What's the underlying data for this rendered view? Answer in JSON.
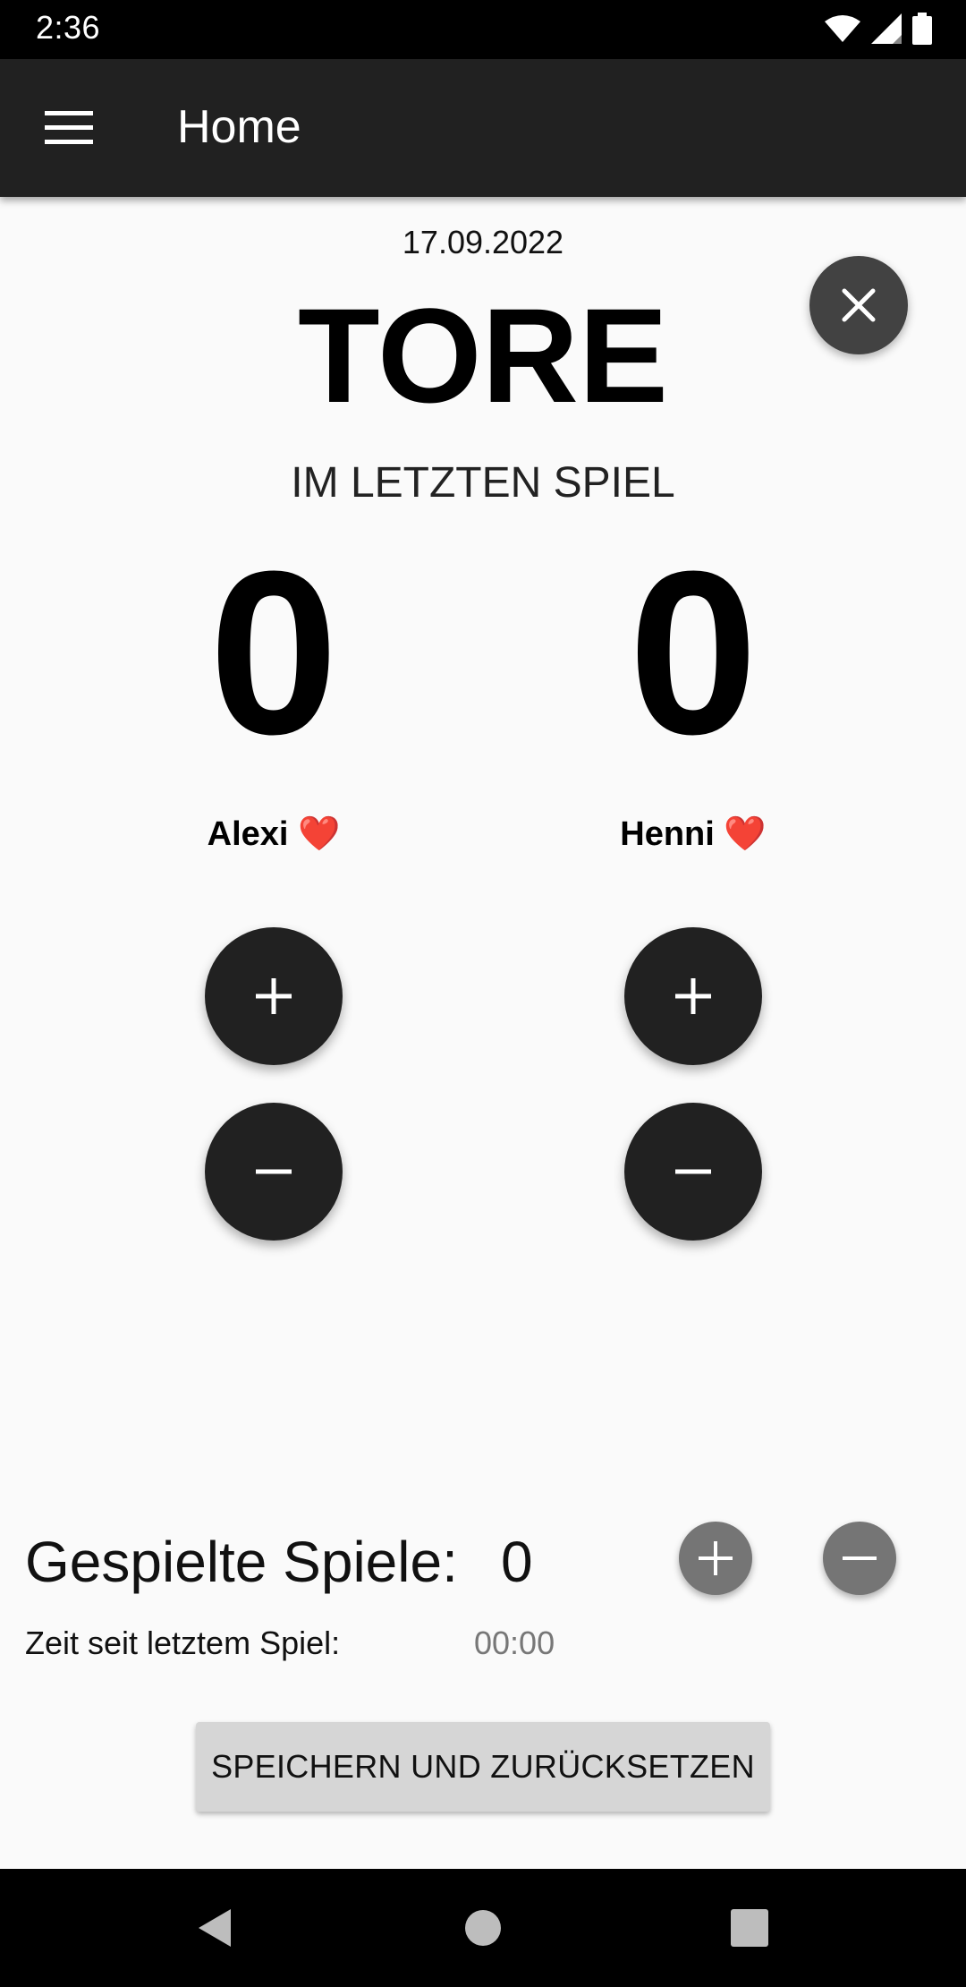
{
  "status_bar": {
    "time": "2:36",
    "icons": [
      "wifi-icon",
      "cellular-signal-icon",
      "battery-icon"
    ]
  },
  "app_bar": {
    "title": "Home",
    "menu_icon": "hamburger-menu-icon"
  },
  "main": {
    "date": "17.09.2022",
    "headline": "TORE",
    "subheadline": "IM LETZTEN SPIEL",
    "players": [
      {
        "name": "Alexi",
        "emoji": "❤️",
        "score": "0"
      },
      {
        "name": "Henni",
        "emoji": "❤️",
        "score": "0"
      }
    ]
  },
  "games": {
    "label": "Gespielte Spiele:",
    "count": "0"
  },
  "time_since": {
    "label": "Zeit seit letztem Spiel:",
    "value": "00:00"
  },
  "actions": {
    "save_reset_label": "SPEICHERN UND ZURÜCKSETZEN"
  },
  "colors": {
    "app_bar": "#212121",
    "background": "#fafafa",
    "fab_dark": "#212121",
    "fab_grey": "#757575",
    "button_grey": "#d6d6d6",
    "heart": "#d81b2a"
  }
}
